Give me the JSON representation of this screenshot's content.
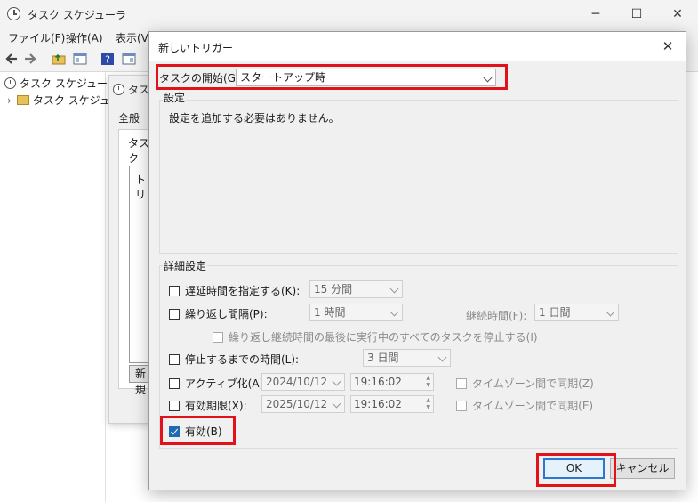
{
  "main_window": {
    "title": "タスク スケジューラ",
    "controls": {
      "minimize": "─",
      "maximize": "☐",
      "close": "✕"
    },
    "menu": [
      "ファイル(F)",
      "操作(A)",
      "表示(V)"
    ],
    "tree": {
      "root": "タスク スケジューラ (ロ",
      "child": "タスク スケジューラ"
    }
  },
  "properties_window": {
    "title": "タス",
    "tab_general": "全般",
    "tab_sub": "タスク",
    "list_text": "トリ",
    "button": "新規"
  },
  "dialog": {
    "title": "新しいトリガー",
    "close": "✕",
    "begin_label": "タスクの開始(G):",
    "begin_value": "スタートアップ時",
    "settings_group": "設定",
    "settings_text": "設定を追加する必要はありません。",
    "advanced_group": "詳細設定",
    "delay": {
      "label": "遅延時間を指定する(K):",
      "value": "15 分間",
      "checked": false
    },
    "repeat": {
      "label": "繰り返し間隔(P):",
      "value": "1 時間",
      "checked": false
    },
    "duration": {
      "label": "継続時間(F):",
      "value": "1 日間"
    },
    "stop_running": {
      "label": "繰り返し継続時間の最後に実行中のすべてのタスクを停止する(I)"
    },
    "stop_after": {
      "label": "停止するまでの時間(L):",
      "value": "3 日間",
      "checked": false
    },
    "activate": {
      "label": "アクティブ化(A):",
      "date": "2024/10/12",
      "time": "19:16:02",
      "sync": "タイムゾーン間で同期(Z)",
      "checked": false
    },
    "expire": {
      "label": "有効期限(X):",
      "date": "2025/10/12",
      "time": "19:16:02",
      "sync": "タイムゾーン間で同期(E)",
      "checked": false
    },
    "enabled": {
      "label": "有効(B)",
      "checked": true
    },
    "ok": "OK",
    "cancel": "キャンセル"
  },
  "colors": {
    "highlight": "#e2121a",
    "accent": "#1f6ab5"
  }
}
